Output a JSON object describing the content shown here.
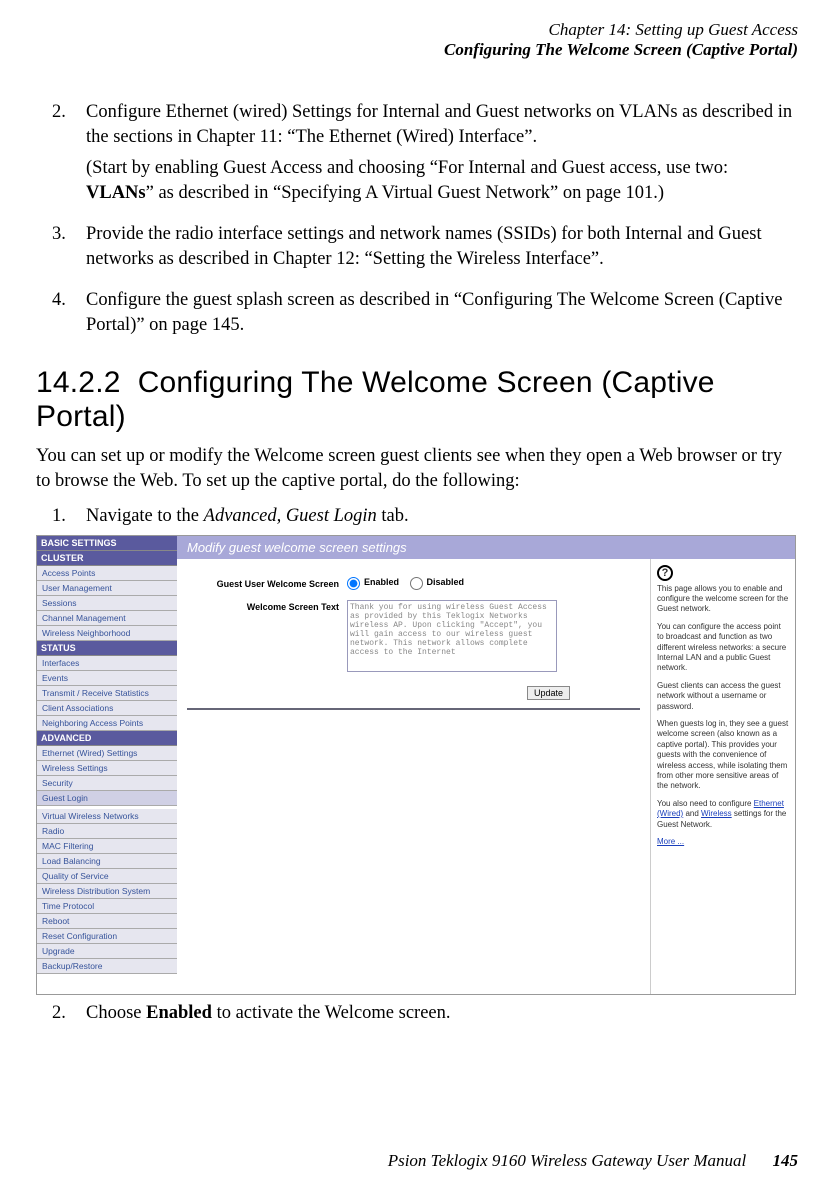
{
  "header": {
    "chapter": "Chapter 14:  Setting up Guest Access",
    "subtitle": "Configuring The Welcome Screen (Captive Portal)"
  },
  "steps_top": [
    {
      "num": "2.",
      "paras": [
        "Configure Ethernet (wired) Settings for Internal and Guest networks on VLANs as described in the sections in Chapter 11: “The Ethernet (Wired) Interface”.",
        "(Start by enabling Guest Access and choosing “For Internal and Guest access, use two: ",
        "VLANs",
        "” as described in “Specifying A Virtual Guest Network” on page 101.)"
      ]
    },
    {
      "num": "3.",
      "paras": [
        "Provide the radio interface settings and network names (SSIDs) for both Internal and Guest networks as described in Chapter 12: “Setting the Wireless Interface”."
      ]
    },
    {
      "num": "4.",
      "paras": [
        "Configure the guest splash screen as described in “Configuring The Welcome Screen (Captive Portal)” on page 145."
      ]
    }
  ],
  "section": {
    "number": "14.2.2",
    "title": "Configuring The Welcome Screen (Captive Portal)",
    "intro": "You can set up or modify the Welcome screen guest clients see when they open a Web browser or try to browse the Web. To set up the captive portal, do the following:"
  },
  "steps_bottom": [
    {
      "num": "1.",
      "text_pre": "Navigate to the ",
      "italic": "Advanced, Guest Login",
      "text_post": " tab."
    },
    {
      "num": "2.",
      "text_pre": "Choose ",
      "bold": "Enabled",
      "text_post": " to activate the Welcome screen."
    }
  ],
  "screenshot": {
    "panel_title": "Modify guest welcome screen settings",
    "nav": {
      "basic": "BASIC SETTINGS",
      "cluster": "CLUSTER",
      "cluster_items": [
        "Access Points",
        "User Management",
        "Sessions",
        "Channel Management",
        "Wireless Neighborhood"
      ],
      "status": "STATUS",
      "status_items": [
        "Interfaces",
        "Events",
        "Transmit / Receive Statistics",
        "Client Associations",
        "Neighboring Access Points"
      ],
      "advanced": "ADVANCED",
      "advanced_items": [
        "Ethernet (Wired) Settings",
        "Wireless Settings",
        "Security",
        "Guest Login",
        "Virtual Wireless Networks",
        "Radio",
        "MAC Filtering",
        "Load Balancing",
        "Quality of Service",
        "Wireless Distribution System",
        "Time Protocol",
        "Reboot",
        "Reset Configuration",
        "Upgrade",
        "Backup/Restore"
      ]
    },
    "form": {
      "label1": "Guest User Welcome Screen",
      "enabled": "Enabled",
      "disabled": "Disabled",
      "label2": "Welcome Screen Text",
      "textarea": "Thank you for using wireless Guest Access as provided by this Teklogix Networks wireless AP. Upon clicking \"Accept\", you will gain access to our wireless guest network. This network allows complete access to the Internet",
      "update": "Update"
    },
    "help": {
      "p1": "This page allows you to enable and configure the welcome screen for the Guest network.",
      "p2": "You can configure the access point to broadcast and function as two different wireless networks: a secure Internal LAN and a public Guest network.",
      "p3": "Guest clients can access the guest network without a username or password.",
      "p4": "When guests log in, they see a guest welcome screen (also known as a captive portal). This provides your guests with the convenience of wireless access, while isolating them from other more sensitive areas of the network.",
      "p5_pre": "You also need to configure ",
      "p5_link1": "Ethernet (Wired)",
      "p5_mid": " and ",
      "p5_link2": "Wireless",
      "p5_post": " settings for the Guest Network.",
      "more": "More ..."
    }
  },
  "footer": {
    "text": "Psion Teklogix 9160 Wireless Gateway User Manual",
    "page": "145"
  }
}
